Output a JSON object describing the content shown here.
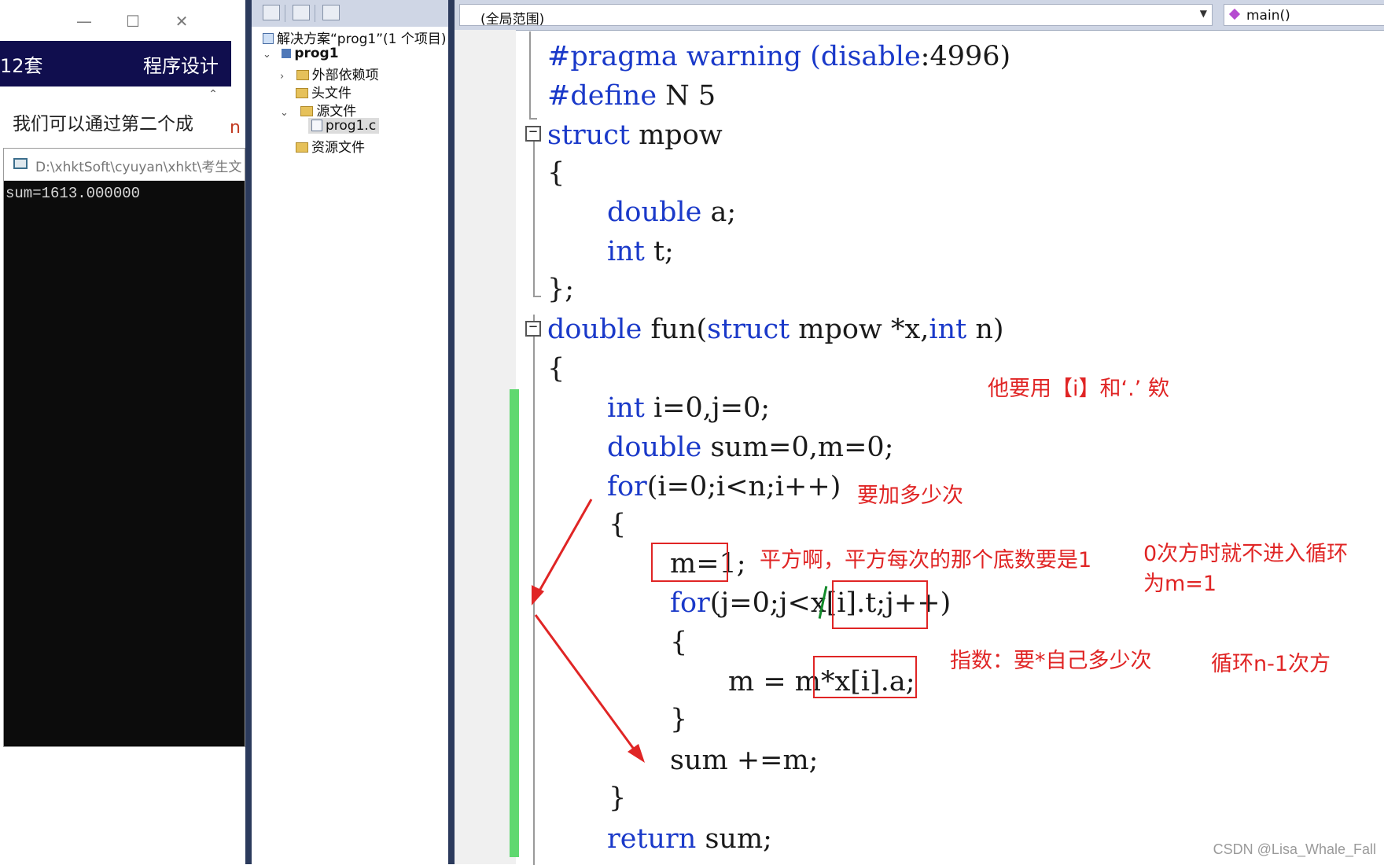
{
  "app": {
    "window_controls": {
      "minimize": "—",
      "maximize": "☐",
      "close": "✕"
    },
    "banner_left": "12套",
    "banner_right": "程序设计",
    "body_text": "我们可以通过第二个成",
    "stray_char": "n"
  },
  "console": {
    "title": "D:\\xhktSoft\\cyuyan\\xhkt\\考生文",
    "output": "sum=1613.000000"
  },
  "solution_explorer": {
    "solution_label": "解决方案“prog1”(1 个项目)",
    "project_label": "prog1",
    "items": [
      {
        "label": "外部依赖项",
        "arrow": "›"
      },
      {
        "label": "头文件",
        "arrow": ""
      },
      {
        "label": "源文件",
        "arrow": "⌄"
      },
      {
        "label": "prog1.c",
        "arrow": ""
      },
      {
        "label": "资源文件",
        "arrow": ""
      }
    ]
  },
  "editor": {
    "scope_dropdown": "(全局范围)",
    "member_dropdown": "main()",
    "code_lines": [
      {
        "parts": [
          {
            "t": "#pragma warning (disable",
            "kw": true
          },
          {
            "t": ":4996)",
            "kw": false
          }
        ]
      },
      {
        "parts": [
          {
            "t": "#define",
            "kw": true
          },
          {
            "t": " N 5",
            "kw": false
          }
        ]
      },
      {
        "parts": [
          {
            "t": "struct",
            "kw": true
          },
          {
            "t": " mpow",
            "kw": false
          }
        ]
      },
      {
        "parts": [
          {
            "t": "{",
            "kw": false
          }
        ]
      },
      {
        "parts": [
          {
            "t": "double",
            "kw": true
          },
          {
            "t": " a;",
            "kw": false
          }
        ]
      },
      {
        "parts": [
          {
            "t": "int",
            "kw": true
          },
          {
            "t": " t;",
            "kw": false
          }
        ]
      },
      {
        "parts": [
          {
            "t": "};",
            "kw": false
          }
        ]
      },
      {
        "parts": [
          {
            "t": "double",
            "kw": true
          },
          {
            "t": " fun(",
            "kw": false
          },
          {
            "t": "struct",
            "kw": true
          },
          {
            "t": " mpow *x,",
            "kw": false
          },
          {
            "t": "int",
            "kw": true
          },
          {
            "t": " n)",
            "kw": false
          }
        ]
      },
      {
        "parts": [
          {
            "t": "{",
            "kw": false
          }
        ]
      },
      {
        "parts": [
          {
            "t": "int",
            "kw": true
          },
          {
            "t": " i=0,j=0;",
            "kw": false
          }
        ]
      },
      {
        "parts": [
          {
            "t": "double",
            "kw": true
          },
          {
            "t": " sum=0,m=0;",
            "kw": false
          }
        ]
      },
      {
        "parts": [
          {
            "t": "for",
            "kw": true
          },
          {
            "t": "(i=0;i<n;i++)",
            "kw": false
          }
        ]
      },
      {
        "parts": [
          {
            "t": "{",
            "kw": false
          }
        ]
      },
      {
        "parts": [
          {
            "t": "m=1;",
            "kw": false
          }
        ]
      },
      {
        "parts": [
          {
            "t": "for",
            "kw": true
          },
          {
            "t": "(j=0;j<x[i].t;j++)",
            "kw": false
          }
        ]
      },
      {
        "parts": [
          {
            "t": "{",
            "kw": false
          }
        ]
      },
      {
        "parts": [
          {
            "t": "m = m*x[i].a;",
            "kw": false
          }
        ]
      },
      {
        "parts": [
          {
            "t": "}",
            "kw": false
          }
        ]
      },
      {
        "parts": [
          {
            "t": "sum +=m;",
            "kw": false
          }
        ]
      },
      {
        "parts": [
          {
            "t": "}",
            "kw": false
          }
        ]
      },
      {
        "parts": [
          {
            "t": "return",
            "kw": true
          },
          {
            "t": " sum;",
            "kw": false
          }
        ]
      }
    ]
  },
  "annotations": {
    "note1": "他要用【i】和‘.’ 欸",
    "note2": "要加多少次",
    "note3": "平方啊，平方每次的那个底数要是1",
    "note4_line1": "0次方时就不进入循环",
    "note4_line2": "为m=1",
    "note5": "指数：要*自己多少次",
    "note6": "循环n-1次方"
  },
  "watermark": "CSDN @Lisa_Whale_Fall",
  "colors": {
    "keyword": "#1a39c9",
    "annotation": "#e02525",
    "change_bar": "#5fd870",
    "banner": "#100e4e",
    "ide_frame": "#2b3a5c"
  }
}
